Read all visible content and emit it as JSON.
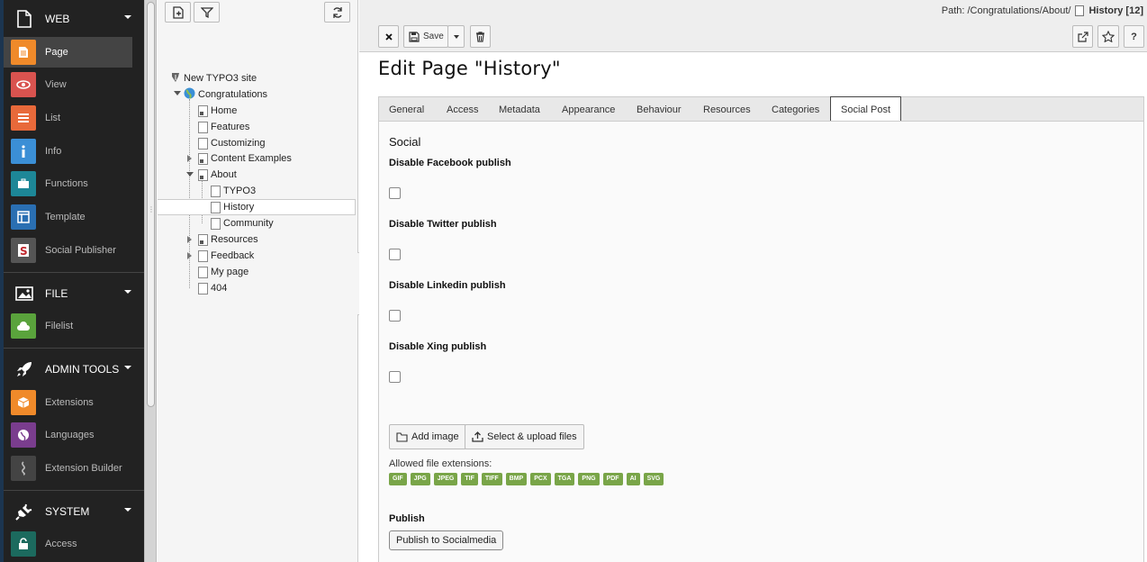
{
  "module_menu": {
    "groups": [
      {
        "label": "WEB",
        "icon": "document-icon",
        "modules": [
          {
            "label": "Page",
            "icon": "page-icon",
            "color": "#f08a2a",
            "active": true
          },
          {
            "label": "View",
            "icon": "eye-icon",
            "color": "#d9534f"
          },
          {
            "label": "List",
            "icon": "list-icon",
            "color": "#e8693a"
          },
          {
            "label": "Info",
            "icon": "info-icon",
            "color": "#3b8fd6"
          },
          {
            "label": "Functions",
            "icon": "toolbox-icon",
            "color": "#1d8797"
          },
          {
            "label": "Template",
            "icon": "template-icon",
            "color": "#2a6fb2"
          },
          {
            "label": "Social Publisher",
            "icon": "social-publisher-icon",
            "color": "#666666"
          }
        ]
      },
      {
        "label": "FILE",
        "icon": "image-icon",
        "modules": [
          {
            "label": "Filelist",
            "icon": "cloud-icon",
            "color": "#5aa33c"
          }
        ]
      },
      {
        "label": "ADMIN TOOLS",
        "icon": "rocket-icon",
        "modules": [
          {
            "label": "Extensions",
            "icon": "box-icon",
            "color": "#f08a2a"
          },
          {
            "label": "Languages",
            "icon": "globe-icon",
            "color": "#7a3d8e"
          },
          {
            "label": "Extension Builder",
            "icon": "extension-builder-icon",
            "color": "#444444"
          }
        ]
      },
      {
        "label": "SYSTEM",
        "icon": "plug-icon",
        "modules": [
          {
            "label": "Access",
            "icon": "lock-icon",
            "color": "#1c6a5e"
          }
        ]
      }
    ]
  },
  "page_tree": {
    "root": "New TYPO3 site",
    "items": [
      {
        "label": "Congratulations",
        "level": 1
      },
      {
        "label": "Home",
        "level": 2
      },
      {
        "label": "Features",
        "level": 2
      },
      {
        "label": "Customizing",
        "level": 2
      },
      {
        "label": "Content Examples",
        "level": 2
      },
      {
        "label": "About",
        "level": 2
      },
      {
        "label": "TYPO3",
        "level": 3
      },
      {
        "label": "History",
        "level": 3,
        "selected": true
      },
      {
        "label": "Community",
        "level": 3
      },
      {
        "label": "Resources",
        "level": 2
      },
      {
        "label": "Feedback",
        "level": 2
      },
      {
        "label": "My page",
        "level": 2
      },
      {
        "label": "404",
        "level": 2
      }
    ]
  },
  "doc_header": {
    "path_label": "Path: /Congratulations/About/",
    "page_ref": "History [12]",
    "save_label": "Save"
  },
  "editor": {
    "title": "Edit Page \"History\"",
    "tabs": [
      "General",
      "Access",
      "Metadata",
      "Appearance",
      "Behaviour",
      "Resources",
      "Categories",
      "Social Post"
    ],
    "active_tab": "Social Post",
    "section_title": "Social",
    "fields": [
      {
        "label": "Disable Facebook publish",
        "checked": false
      },
      {
        "label": "Disable Twitter publish",
        "checked": false
      },
      {
        "label": "Disable Linkedin publish",
        "checked": false
      },
      {
        "label": "Disable Xing publish",
        "checked": false
      }
    ],
    "add_image_label": "Add image",
    "upload_label": "Select & upload files",
    "allowed_ext_label": "Allowed file extensions:",
    "extensions": [
      "GIF",
      "JPG",
      "JPEG",
      "TIF",
      "TIFF",
      "BMP",
      "PCX",
      "TGA",
      "PNG",
      "PDF",
      "AI",
      "SVG"
    ],
    "publish_label": "Publish",
    "publish_button": "Publish to Socialmedia"
  }
}
